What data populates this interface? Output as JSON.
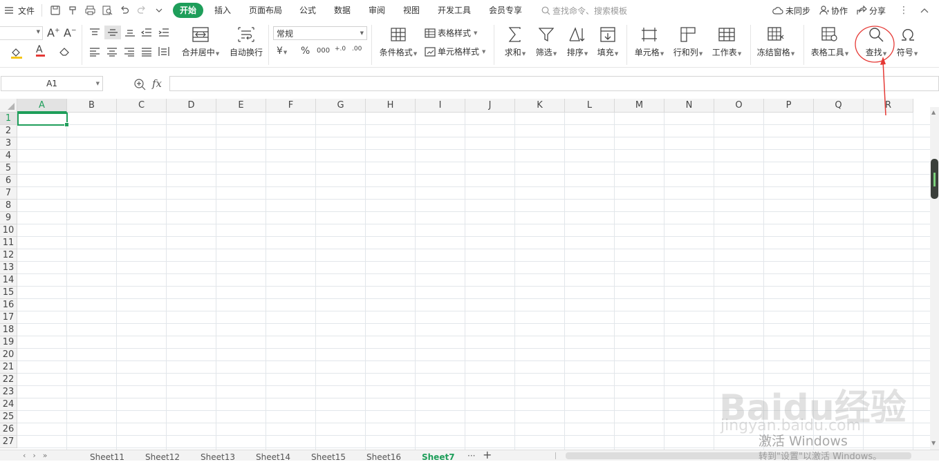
{
  "menubar": {
    "file": "文件",
    "tabs": [
      {
        "label": "开始",
        "active": true
      },
      {
        "label": "插入"
      },
      {
        "label": "页面布局"
      },
      {
        "label": "公式"
      },
      {
        "label": "数据"
      },
      {
        "label": "审阅"
      },
      {
        "label": "视图"
      },
      {
        "label": "开发工具"
      },
      {
        "label": "会员专享"
      }
    ],
    "search_placeholder": "查找命令、搜索模板",
    "sync": "未同步",
    "collab": "协作",
    "share": "分享"
  },
  "ribbon": {
    "merge_center": "合并居中",
    "wrap_text": "自动换行",
    "number_format": "常规",
    "cond_format": "条件格式",
    "table_style": "表格样式",
    "cell_style": "单元格样式",
    "sum": "求和",
    "filter": "筛选",
    "sort": "排序",
    "fill": "填充",
    "cell": "单元格",
    "row_col": "行和列",
    "worksheet": "工作表",
    "freeze": "冻结窗格",
    "table_tools": "表格工具",
    "find": "查找",
    "symbol": "符号",
    "percent": "%",
    "thousands": "000",
    "dec_inc": "+.0",
    "dec_dec": ".00"
  },
  "formula_bar": {
    "name_box": "A1",
    "fx": "fx",
    "value": ""
  },
  "grid": {
    "columns": [
      "A",
      "B",
      "C",
      "D",
      "E",
      "F",
      "G",
      "H",
      "I",
      "J",
      "K",
      "L",
      "M",
      "N",
      "O",
      "P",
      "Q",
      "R"
    ],
    "rows": [
      "1",
      "2",
      "3",
      "4",
      "5",
      "6",
      "7",
      "8",
      "9",
      "10",
      "11",
      "12",
      "13",
      "14",
      "15",
      "16",
      "17",
      "18",
      "19",
      "20",
      "21",
      "22",
      "23",
      "24",
      "25",
      "26",
      "27"
    ],
    "selected_cell": "A1"
  },
  "sheets": [
    "Sheet11",
    "Sheet12",
    "Sheet13",
    "Sheet14",
    "Sheet15",
    "Sheet16",
    "Sheet7"
  ],
  "active_sheet": "Sheet7",
  "sheet_more": "···",
  "sheet_add": "+",
  "watermark": {
    "baidu_brand": "Baidu经验",
    "baidu_url": "jingyan.baidu.com",
    "activate_title": "激活 Windows",
    "activate_sub": "转到\"设置\"以激活 Windows。"
  },
  "colors": {
    "accent": "#1e9e5a",
    "annotation": "#e53935"
  }
}
